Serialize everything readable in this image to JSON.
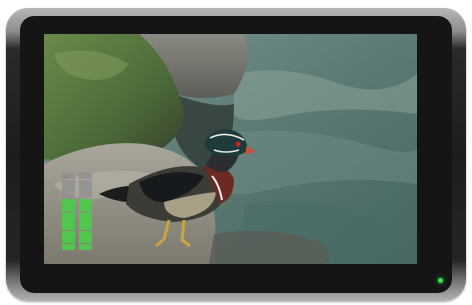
{
  "device": {
    "led_color": "#38e05a",
    "bezel_color": "#151515"
  },
  "video": {
    "subject": "wood-duck-on-rock"
  },
  "audio_meter": {
    "channels": [
      {
        "level": 0.7
      },
      {
        "level": 0.7
      }
    ],
    "segments": 12,
    "active_color": "#4ec94b",
    "idle_color": "#8d8d8d"
  }
}
